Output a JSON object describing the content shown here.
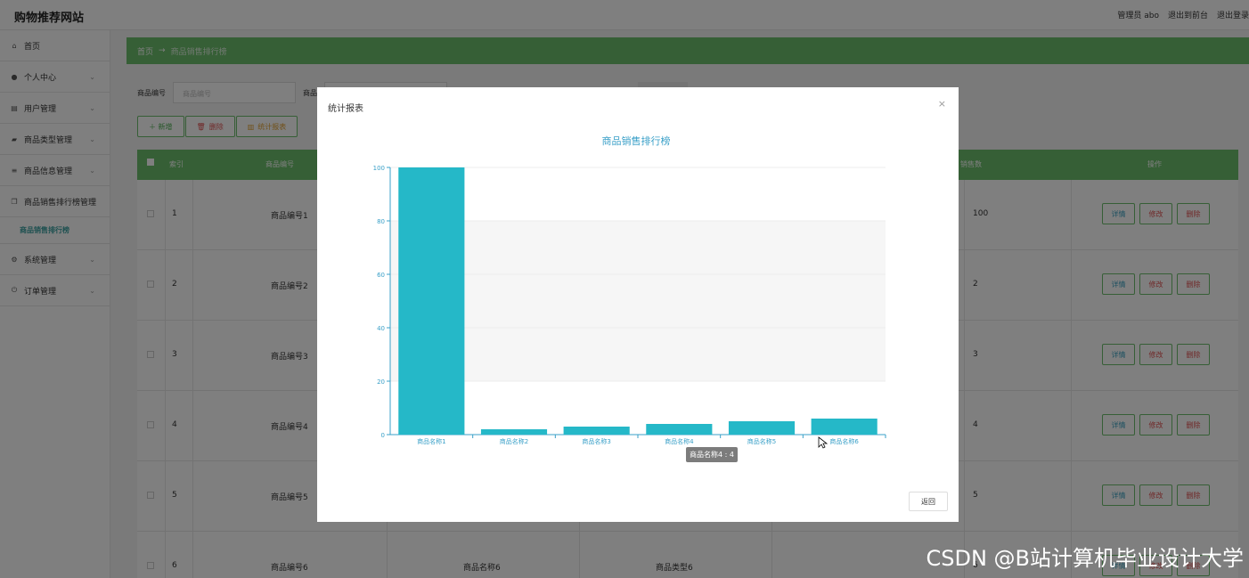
{
  "app": {
    "title": "购物推荐网站"
  },
  "topbar": {
    "role": "管理员 abo",
    "to_front": "退出到前台",
    "logout": "退出登录"
  },
  "sidebar": {
    "items": [
      {
        "label": "首页",
        "icon": "home-icon",
        "expandable": false
      },
      {
        "label": "个人中心",
        "icon": "person-icon",
        "expandable": true
      },
      {
        "label": "用户管理",
        "icon": "user-manage-icon",
        "expandable": true
      },
      {
        "label": "商品类型管理",
        "icon": "category-icon",
        "expandable": true
      },
      {
        "label": "商品信息管理",
        "icon": "list-icon",
        "expandable": true
      },
      {
        "label": "商品销售排行榜管理",
        "icon": "ranking-icon",
        "expandable": true
      }
    ],
    "sub_item": "商品销售排行榜",
    "items_after": [
      {
        "label": "系统管理",
        "icon": "gear-icon",
        "expandable": true
      },
      {
        "label": "订单管理",
        "icon": "order-icon",
        "expandable": true
      }
    ]
  },
  "breadcrumb": {
    "home": "首页",
    "arrow": "→",
    "current": "商品销售排行榜"
  },
  "search": {
    "label1": "商品编号",
    "placeholder1": "商品编号",
    "label2": "商品"
  },
  "actions": {
    "add": "＋ 新增",
    "delete": "删除",
    "report": "统计报表"
  },
  "table": {
    "headers": {
      "index": "索引",
      "code": "商品编号",
      "sales": "销售数",
      "ops": "操作"
    },
    "rows": [
      {
        "index": "1",
        "code": "商品编号1",
        "sales": "100"
      },
      {
        "index": "2",
        "code": "商品编号2",
        "sales": "2"
      },
      {
        "index": "3",
        "code": "商品编号3",
        "sales": "3"
      },
      {
        "index": "4",
        "code": "商品编号4",
        "sales": "4"
      },
      {
        "index": "5",
        "code": "商品编号5",
        "sales": "5"
      },
      {
        "index": "6",
        "code": "商品编号6",
        "name": "商品名称6",
        "type": "商品类型6",
        "sales": "6"
      }
    ],
    "op_labels": {
      "detail": "详情",
      "edit": "修改",
      "delete": "删除"
    }
  },
  "modal": {
    "title": "统计报表",
    "close": "×",
    "back": "返回"
  },
  "chart_data": {
    "type": "bar",
    "title": "商品销售排行榜",
    "categories": [
      "商品名称1",
      "商品名称2",
      "商品名称3",
      "商品名称4",
      "商品名称5",
      "商品名称6"
    ],
    "values": [
      100,
      2,
      3,
      4,
      5,
      6
    ],
    "ylim": [
      0,
      100
    ],
    "yticks": [
      0,
      20,
      40,
      60,
      80,
      100
    ],
    "xlabel": "",
    "ylabel": "",
    "bar_color": "#25b8c8",
    "title_color": "#3aa0c8",
    "grid": "alternating-bands",
    "tooltip": "商品名称4 : 4"
  },
  "watermark": "CSDN @B站计算机毕业设计大学"
}
